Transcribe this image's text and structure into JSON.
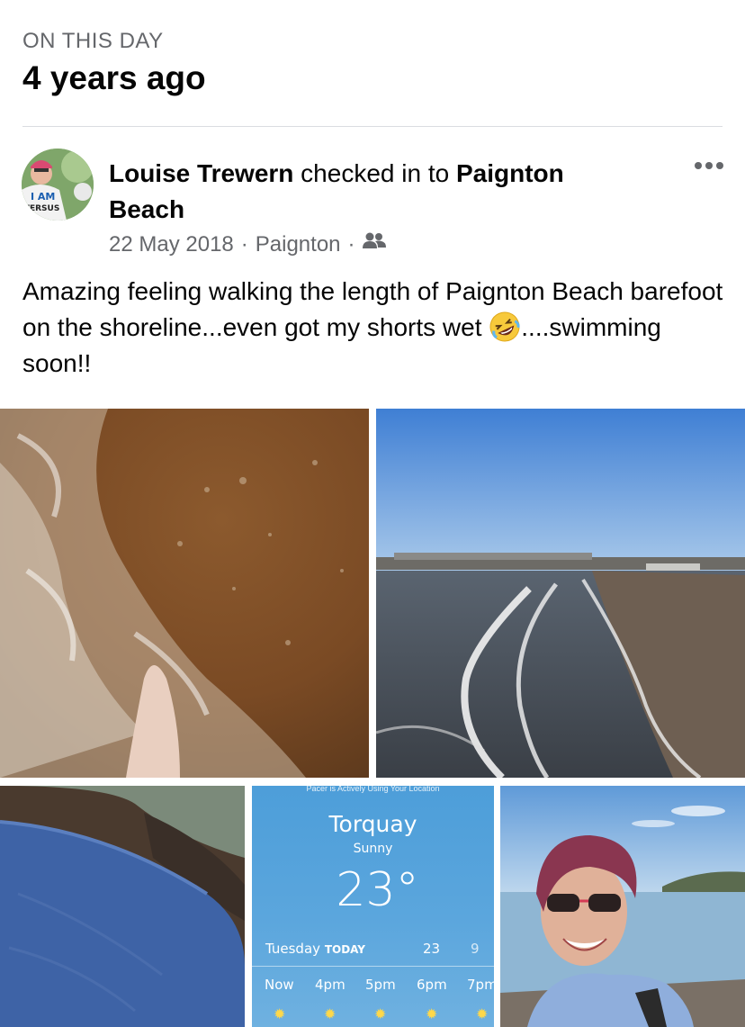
{
  "memory": {
    "label": "ON THIS DAY",
    "title": "4 years ago"
  },
  "post": {
    "author": "Louise Trewern",
    "action": " checked in to ",
    "place": "Paignton Beach",
    "date": "22 May 2018",
    "location": "Paignton",
    "separator": "·",
    "text_line": "Amazing feeling walking the length of Paignton Beach barefoot on the shoreline...even got my shorts wet ",
    "text_end": "....swimming soon!!",
    "avatar_text_1": "I AM",
    "avatar_text_2": "VERSUS",
    "icons": {
      "more": "more-options-icon",
      "audience": "friends-audience-icon",
      "emoji": "rolling-laughing-emoji"
    }
  },
  "weather_widget": {
    "banner": "Pacer is Actively Using Your Location",
    "city": "Torquay",
    "condition": "Sunny",
    "temperature": "23°",
    "day": "Tuesday",
    "today": "TODAY",
    "high": "23",
    "low": "9",
    "hours": [
      "Now",
      "4pm",
      "5pm",
      "6pm",
      "7pm"
    ]
  },
  "colors": {
    "text_primary": "#050505",
    "text_secondary": "#65676b",
    "divider": "#dadde1",
    "weather_bg": "#5ba6dd"
  }
}
